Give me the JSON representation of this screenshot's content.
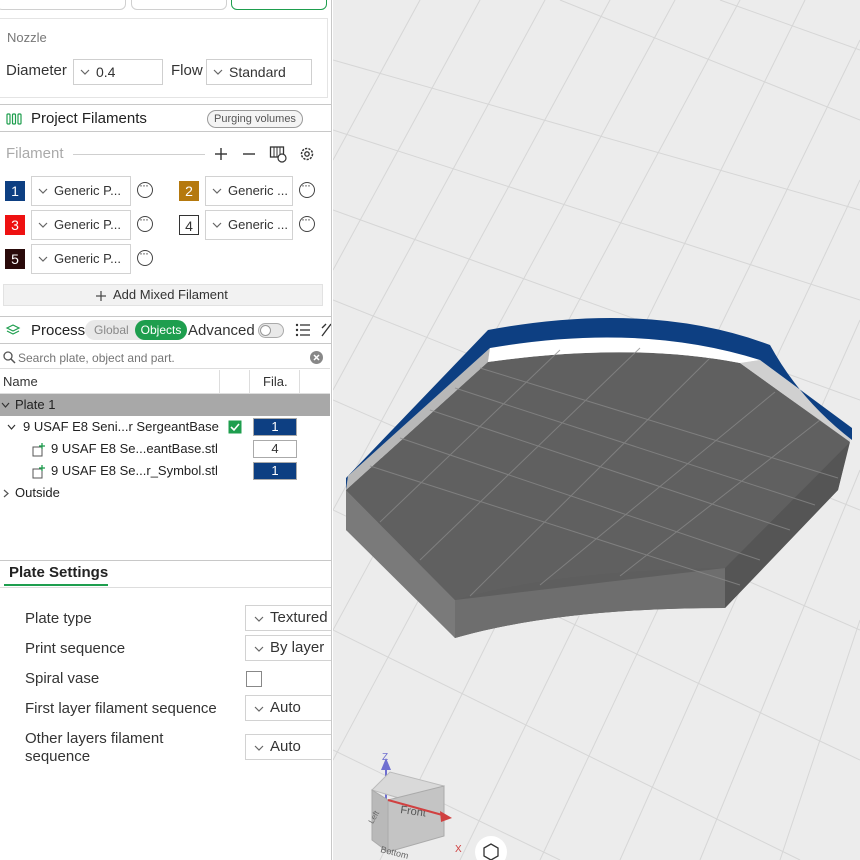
{
  "nozzle": {
    "group_label": "Nozzle",
    "diameter_label": "Diameter",
    "diameter_value": "0.4",
    "flow_label": "Flow",
    "flow_value": "Standard"
  },
  "project_filaments": {
    "title": "Project Filaments",
    "purging_button": "Purging volumes",
    "filament_label": "Filament",
    "items": [
      {
        "num": "1",
        "name": "Generic P...",
        "color": "#0d3f82",
        "text_color": "#ffffff"
      },
      {
        "num": "2",
        "name": "Generic ...",
        "color": "#b5790e",
        "text_color": "#ffffff"
      },
      {
        "num": "3",
        "name": "Generic P...",
        "color": "#ee1111",
        "text_color": "#ffffff"
      },
      {
        "num": "4",
        "name": "Generic ...",
        "color": "#ffffff",
        "text_color": "#333333"
      },
      {
        "num": "5",
        "name": "Generic P...",
        "color": "#2a0a0a",
        "text_color": "#ffffff"
      }
    ],
    "add_mixed_label": "Add Mixed Filament"
  },
  "process": {
    "title": "Process",
    "toggle_global": "Global",
    "toggle_objects": "Objects",
    "advanced_label": "Advanced"
  },
  "search": {
    "placeholder": "Search plate, object and part."
  },
  "object_list": {
    "col_name": "Name",
    "col_fila": "Fila.",
    "plate_label": "Plate 1",
    "rows": [
      {
        "name": "9 USAF E8 Seni...r SergeantBase",
        "fila": "1",
        "fila_color": "#0d3f82",
        "fila_text": "#ffffff"
      },
      {
        "name": "9 USAF E8 Se...eantBase.stl",
        "fila": "4",
        "fila_color": "#ffffff",
        "fila_text": "#333333"
      },
      {
        "name": "9 USAF E8 Se...r_Symbol.stl",
        "fila": "1",
        "fila_color": "#0d3f82",
        "fila_text": "#ffffff"
      }
    ],
    "outside_label": "Outside"
  },
  "plate_settings": {
    "tab_label": "Plate Settings",
    "settings": [
      {
        "label": "Plate type",
        "value": "Textured"
      },
      {
        "label": "Print sequence",
        "value": "By layer"
      },
      {
        "label": "Spiral vase",
        "value": ""
      },
      {
        "label": "First layer filament sequence",
        "value": "Auto"
      },
      {
        "label": "Other layers filament sequence",
        "value": "Auto"
      }
    ]
  },
  "viewcube": {
    "axis_z": "Z",
    "axis_x": "X",
    "face_front": "Front",
    "face_left": "Left",
    "face_bottom": "Bottom"
  },
  "colors": {
    "accent_green": "#1e9e4e",
    "model_blue": "#0d3f82",
    "model_gray": "#646464"
  }
}
